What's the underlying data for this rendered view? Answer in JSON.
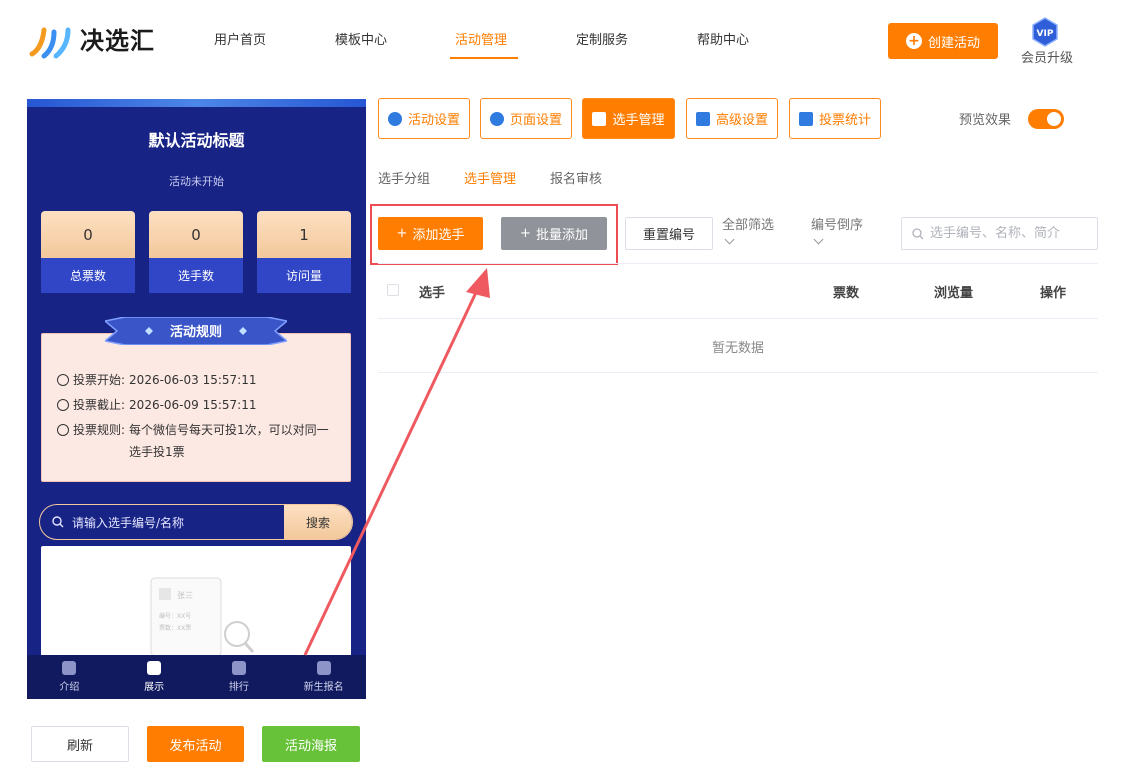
{
  "header": {
    "logo_text": "决选汇",
    "nav": [
      "用户首页",
      "模板中心",
      "活动管理",
      "定制服务",
      "帮助中心"
    ],
    "create_button": "创建活动",
    "vip_badge": "VIP",
    "vip_label": "会员升级"
  },
  "preview": {
    "title": "默认活动标题",
    "status": "活动未开始",
    "stats": [
      {
        "value": "0",
        "label": "总票数"
      },
      {
        "value": "0",
        "label": "选手数"
      },
      {
        "value": "1",
        "label": "访问量"
      }
    ],
    "rules_title": "活动规则",
    "rules": [
      {
        "label": "投票开始:",
        "value": "2026-06-03 15:57:11"
      },
      {
        "label": "投票截止:",
        "value": "2026-06-09 15:57:11"
      },
      {
        "label": "投票规则:",
        "value": "每个微信号每天可投1次，可以对同一选手投1票"
      }
    ],
    "search_placeholder": "请输入选手编号/名称",
    "search_button": "搜索",
    "empty_card": {
      "name": "张三",
      "number": "编号：XX号",
      "votes": "票数：XX票"
    },
    "tabbar": [
      "介绍",
      "展示",
      "排行",
      "新生报名"
    ]
  },
  "actions": {
    "refresh": "刷新",
    "publish": "发布活动",
    "poster": "活动海报"
  },
  "tabs": [
    "活动设置",
    "页面设置",
    "选手管理",
    "高级设置",
    "投票统计"
  ],
  "preview_toggle_label": "预览效果",
  "subtabs": [
    "选手分组",
    "选手管理",
    "报名审核"
  ],
  "toolbar": {
    "add": "添加选手",
    "batch_add": "批量添加",
    "reset_number": "重置编号",
    "filter_all": "全部筛选",
    "sort_desc": "编号倒序",
    "search_placeholder": "选手编号、名称、简介"
  },
  "table": {
    "columns": [
      "选手",
      "票数",
      "浏览量",
      "操作"
    ],
    "empty": "暂无数据"
  },
  "colors": {
    "accent": "#ff7d00",
    "preview_bg": "#182386",
    "success": "#67c23a",
    "annotation": "#ef4b53"
  }
}
